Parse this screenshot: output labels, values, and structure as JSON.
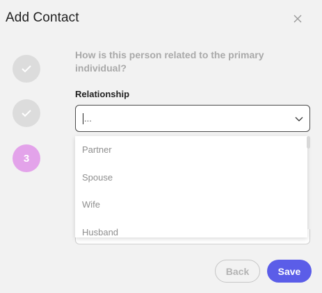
{
  "dialog": {
    "title": "Add Contact"
  },
  "steps": [
    {
      "state": "done",
      "icon": "check-icon"
    },
    {
      "state": "done",
      "icon": "check-icon"
    },
    {
      "state": "active",
      "label": "3"
    }
  ],
  "form": {
    "question": "How is this person related to the primary individual?",
    "relationship_label": "Relationship",
    "relationship_value": "...",
    "options": [
      "Partner",
      "Spouse",
      "Wife",
      "Husband"
    ]
  },
  "buttons": {
    "back": "Back",
    "save": "Save"
  },
  "colors": {
    "accent": "#5b5de8",
    "active_step": "#e3a3ea",
    "done_step": "#dcdcdc"
  }
}
